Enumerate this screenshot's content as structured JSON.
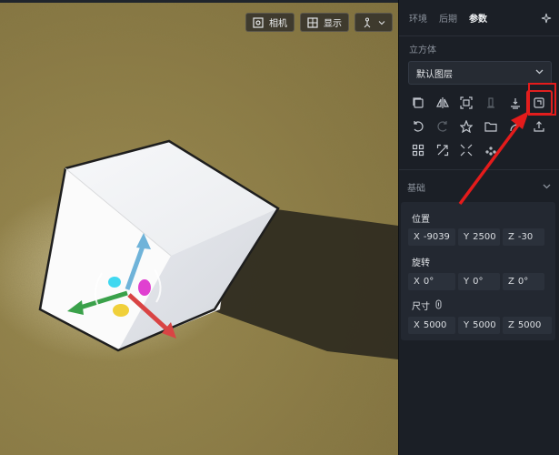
{
  "viewport": {
    "camera_label": "相机",
    "display_label": "显示"
  },
  "panel": {
    "tabs": [
      "环境",
      "后期",
      "参数"
    ],
    "active_tab": "参数",
    "object_type": "立方体",
    "layer_select": "默认图层",
    "basic_section": "基础",
    "position": {
      "label": "位置",
      "x": "-9039",
      "y": "2500",
      "z": "-30"
    },
    "rotation": {
      "label": "旋转",
      "x": "0°",
      "y": "0°",
      "z": "0°"
    },
    "size": {
      "label": "尺寸",
      "x": "5000",
      "y": "5000",
      "z": "5000"
    }
  },
  "colors": {
    "panel_bg": "#1b1f26",
    "field_bg": "#2b313b",
    "annotation_red": "#e41b1b"
  },
  "toolbar_icons": [
    [
      "copy-icon",
      "mirror-icon",
      "focus-icon",
      "pillar-icon",
      "ground-snap-icon",
      "import-model-icon"
    ],
    [
      "undo-icon",
      "redo-icon",
      "star-icon",
      "folder-icon",
      "share-icon",
      "upload-icon"
    ],
    [
      "grid-icon",
      "scale-icon",
      "expand-icon",
      "scatter-icon"
    ]
  ]
}
